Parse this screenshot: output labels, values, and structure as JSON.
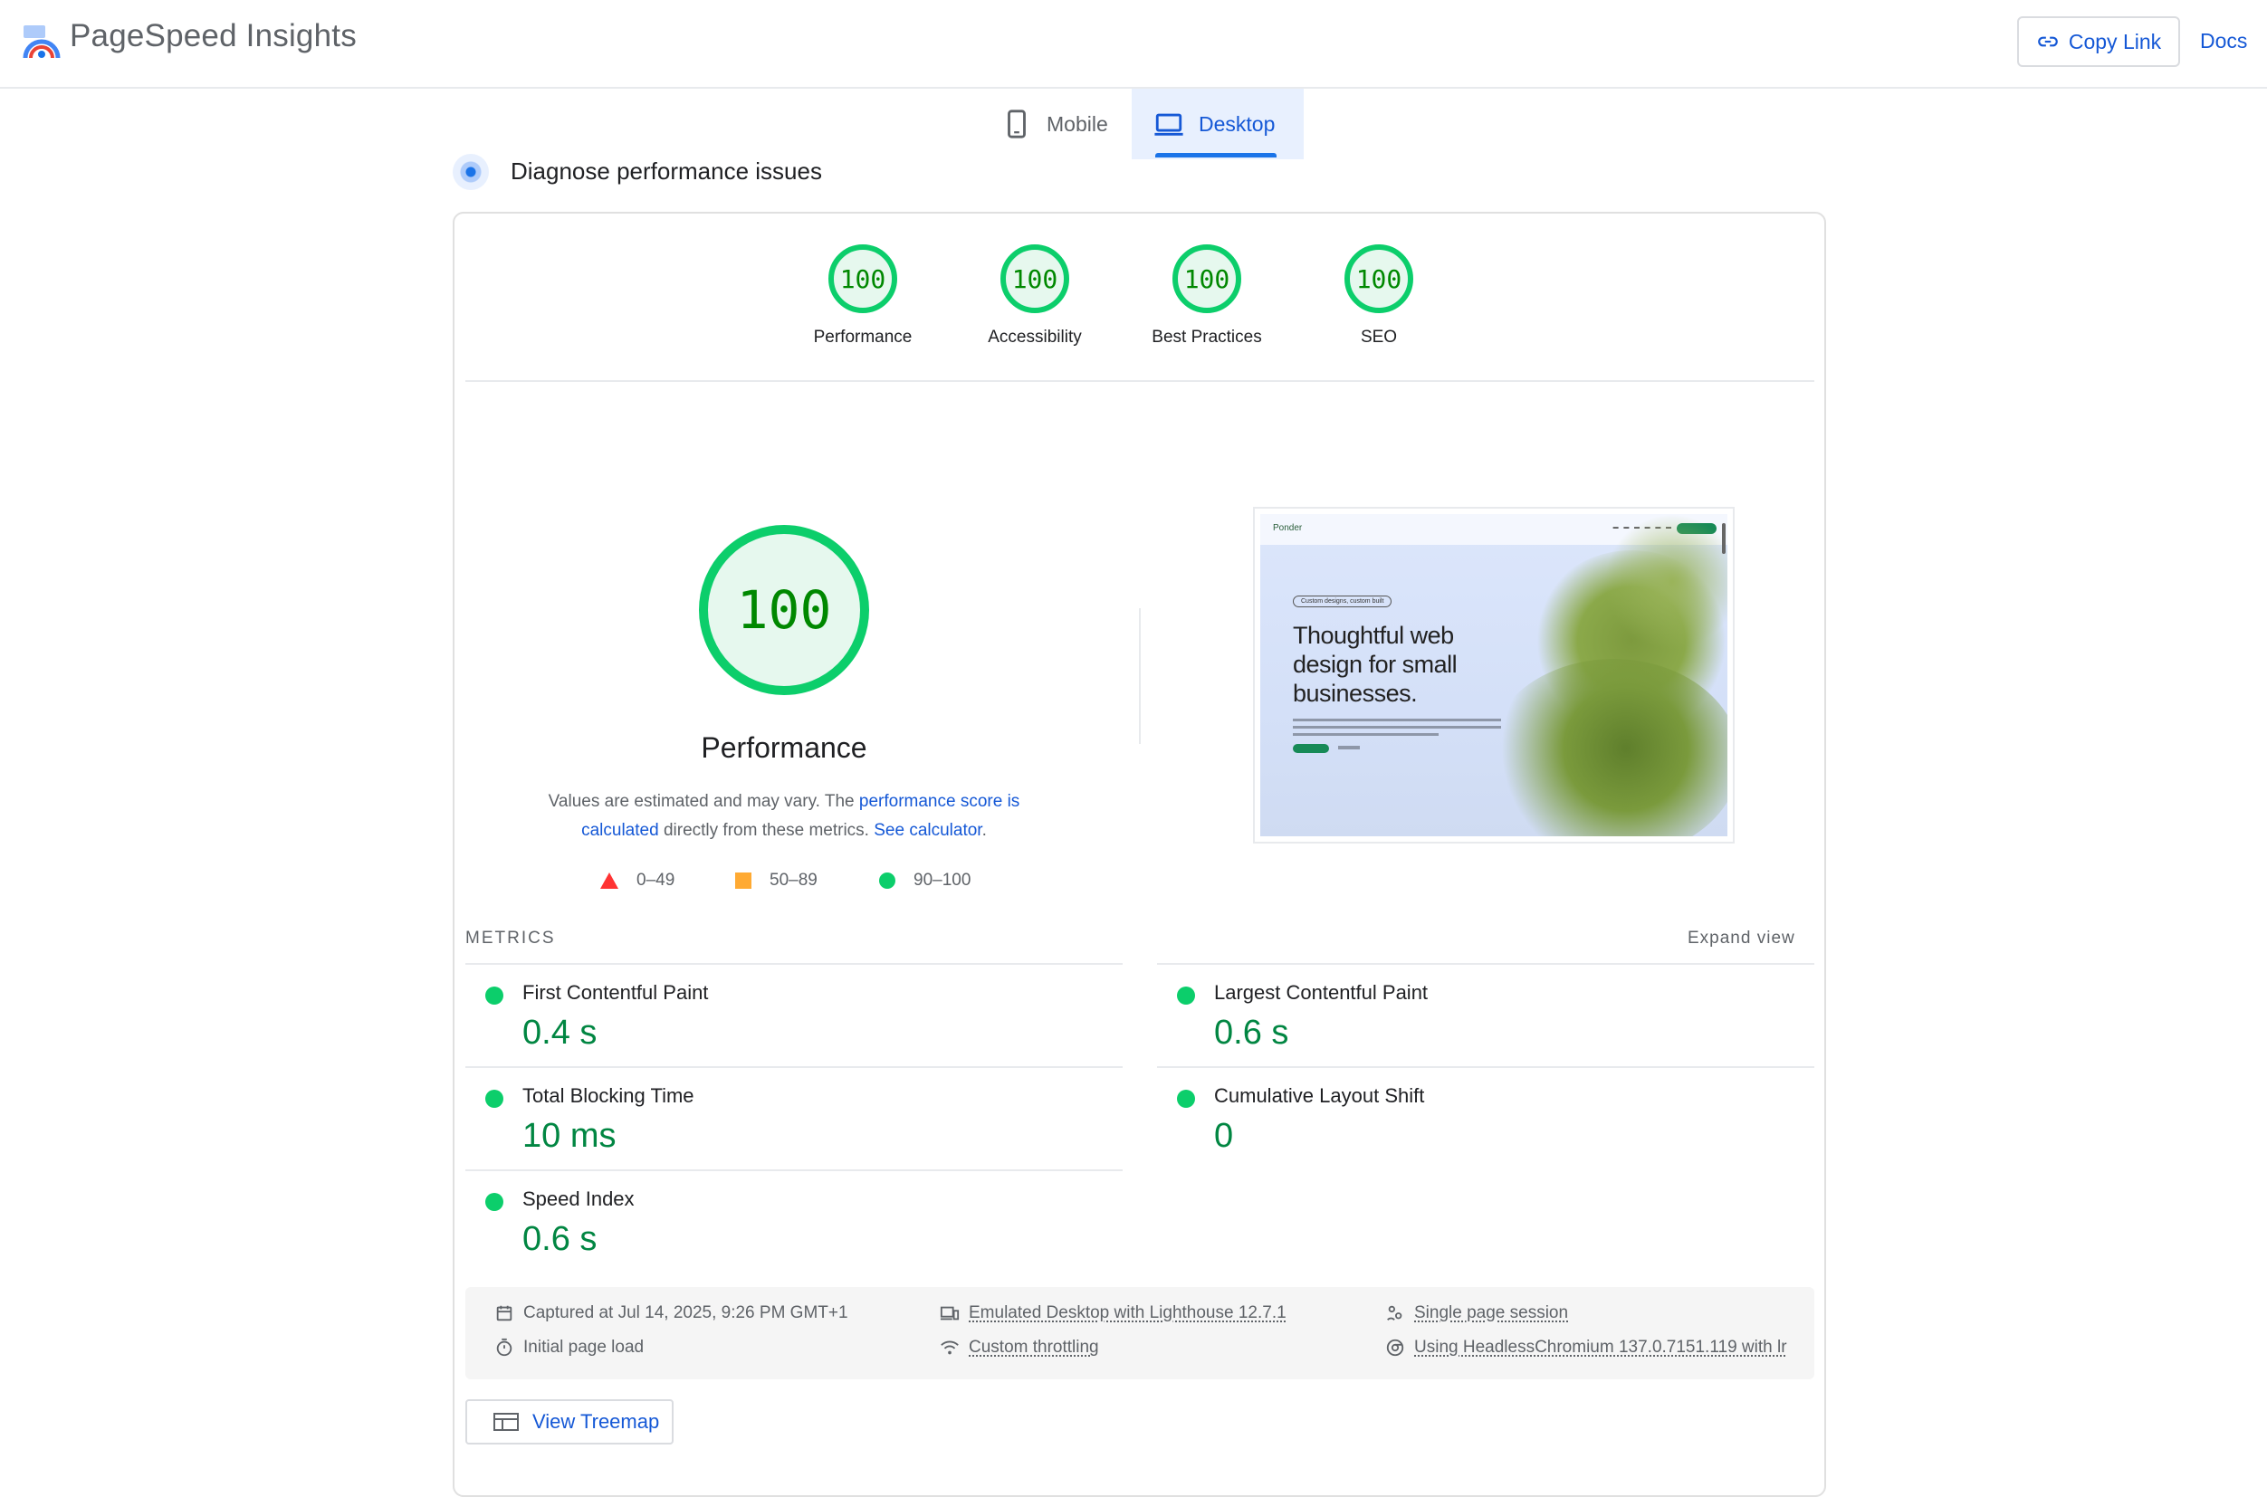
{
  "header": {
    "brand": "PageSpeed Insights",
    "copy_link": "Copy Link",
    "docs": "Docs"
  },
  "tabs": [
    {
      "label": "Mobile",
      "icon": "smartphone-icon",
      "selected": false
    },
    {
      "label": "Desktop",
      "icon": "laptop-icon",
      "selected": true
    }
  ],
  "section_title": "Diagnose performance issues",
  "category_scores": [
    {
      "score": "100",
      "label": "Performance"
    },
    {
      "score": "100",
      "label": "Accessibility"
    },
    {
      "score": "100",
      "label": "Best Practices"
    },
    {
      "score": "100",
      "label": "SEO"
    }
  ],
  "performance": {
    "score": "100",
    "title": "Performance",
    "desc_prefix": "Values are estimated and may vary. The ",
    "desc_link1": "performance score is calculated",
    "desc_middle": " directly from these metrics. ",
    "desc_link2": "See calculator",
    "desc_suffix": "."
  },
  "legend": [
    {
      "range": "0–49",
      "color": "#ff3333"
    },
    {
      "range": "50–89",
      "color": "#ffaa33"
    },
    {
      "range": "90–100",
      "color": "#0cce6b"
    }
  ],
  "screenshot_preview": {
    "logo": "Ponder",
    "chip": "Custom designs, custom built",
    "headline": "Thoughtful web design for small businesses."
  },
  "metrics": {
    "heading": "METRICS",
    "expand": "Expand view",
    "items": [
      {
        "name": "First Contentful Paint",
        "value": "0.4 s"
      },
      {
        "name": "Largest Contentful Paint",
        "value": "0.6 s"
      },
      {
        "name": "Total Blocking Time",
        "value": "10 ms"
      },
      {
        "name": "Cumulative Layout Shift",
        "value": "0"
      },
      {
        "name": "Speed Index",
        "value": "0.6 s"
      }
    ]
  },
  "run_info": {
    "captured": "Captured at Jul 14, 2025, 9:26 PM GMT+1",
    "load": "Initial page load",
    "emulated": "Emulated Desktop with Lighthouse 12.7.1",
    "throttling": "Custom throttling",
    "session": "Single page session",
    "browser": "Using HeadlessChromium 137.0.7151.119 with lr"
  },
  "treemap_button": "View Treemap",
  "colors": {
    "pass": "#0cce6b",
    "pass_text": "#018642",
    "link": "#1558d6"
  }
}
